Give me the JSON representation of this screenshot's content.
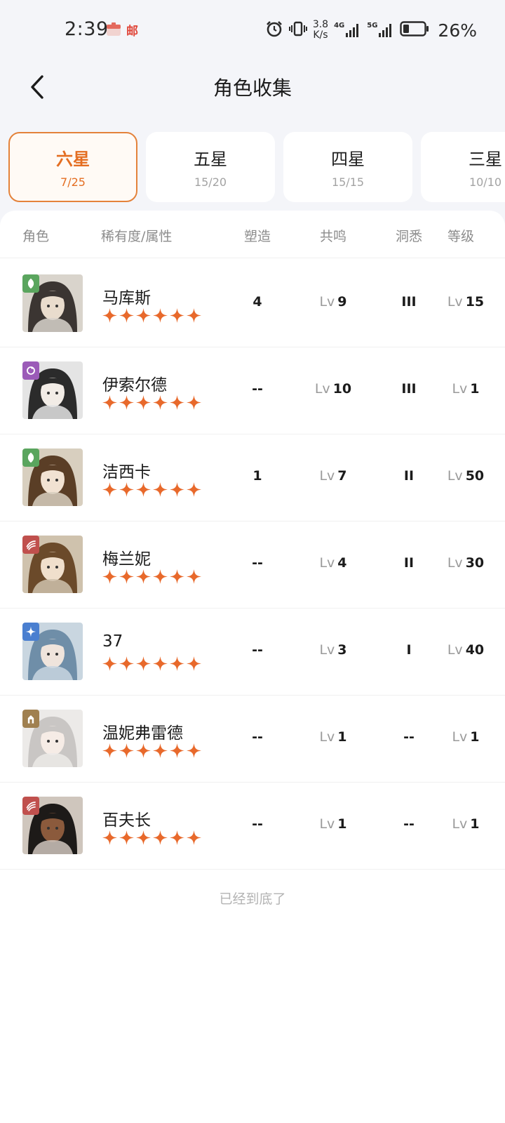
{
  "status_bar": {
    "time": "2:39",
    "notif_text": "邮",
    "net_speed_value": "3.8",
    "net_speed_unit": "K/s",
    "sim1": "4G",
    "sim2": "5G",
    "battery": "26%"
  },
  "header": {
    "title": "角色收集"
  },
  "tabs": [
    {
      "label": "六星",
      "count": "7/25",
      "active": true
    },
    {
      "label": "五星",
      "count": "15/20",
      "active": false
    },
    {
      "label": "四星",
      "count": "15/15",
      "active": false
    },
    {
      "label": "三星",
      "count": "10/10",
      "active": false
    }
  ],
  "table": {
    "headers": {
      "role": "角色",
      "rarity": "稀有度/属性",
      "shape": "塑造",
      "reson": "共鸣",
      "insight": "洞悉",
      "level": "等级"
    },
    "lv_prefix": "Lv",
    "star_color": "#e8692b",
    "rows": [
      {
        "name": "马库斯",
        "stars": 6,
        "attr": "plant",
        "attr_color": "#5aa55e",
        "shape": "4",
        "reson": "9",
        "insight": "III",
        "level": "15"
      },
      {
        "name": "伊索尔德",
        "stars": 6,
        "attr": "spirit",
        "attr_color": "#9b5bb8",
        "shape": "--",
        "reson": "10",
        "insight": "III",
        "level": "1"
      },
      {
        "name": "洁西卡",
        "stars": 6,
        "attr": "plant",
        "attr_color": "#5aa55e",
        "shape": "1",
        "reson": "7",
        "insight": "II",
        "level": "50"
      },
      {
        "name": "梅兰妮",
        "stars": 6,
        "attr": "beast",
        "attr_color": "#c0504d",
        "shape": "--",
        "reson": "4",
        "insight": "II",
        "level": "30"
      },
      {
        "name": "37",
        "stars": 6,
        "attr": "star",
        "attr_color": "#4a7fd0",
        "shape": "--",
        "reson": "3",
        "insight": "I",
        "level": "40"
      },
      {
        "name": "温妮弗雷德",
        "stars": 6,
        "attr": "mineral",
        "attr_color": "#a08050",
        "shape": "--",
        "reson": "1",
        "insight": "--",
        "level": "1"
      },
      {
        "name": "百夫长",
        "stars": 6,
        "attr": "beast",
        "attr_color": "#c0504d",
        "shape": "--",
        "reson": "1",
        "insight": "--",
        "level": "1"
      }
    ]
  },
  "footer": {
    "end_text": "已经到底了"
  }
}
